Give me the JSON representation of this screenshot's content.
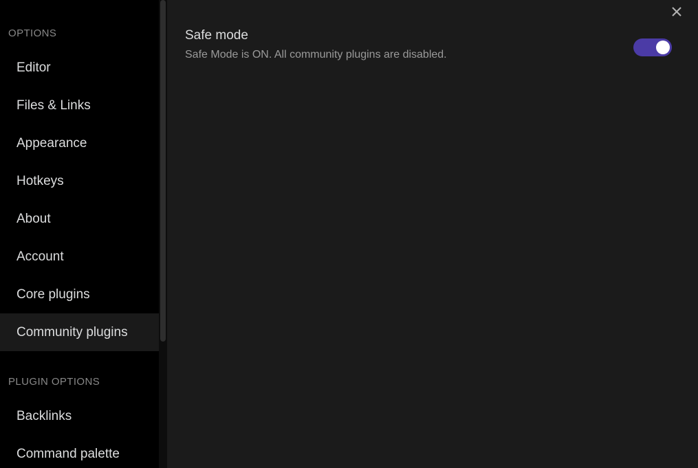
{
  "colors": {
    "sidebar_bg": "#000000",
    "content_bg": "#1b1b1b",
    "active_item_bg": "#1a1a1a",
    "text_primary": "#dcddde",
    "text_muted": "#9a9a9a",
    "section_header": "#888888",
    "toggle_on": "#4b3ba6",
    "toggle_knob": "#ffffff",
    "scrollbar_thumb": "#2e2e2e"
  },
  "sidebar": {
    "sections": [
      {
        "header": "OPTIONS",
        "items": [
          {
            "label": "Editor",
            "active": false
          },
          {
            "label": "Files & Links",
            "active": false
          },
          {
            "label": "Appearance",
            "active": false
          },
          {
            "label": "Hotkeys",
            "active": false
          },
          {
            "label": "About",
            "active": false
          },
          {
            "label": "Account",
            "active": false
          },
          {
            "label": "Core plugins",
            "active": false
          },
          {
            "label": "Community plugins",
            "active": true
          }
        ]
      },
      {
        "header": "PLUGIN OPTIONS",
        "items": [
          {
            "label": "Backlinks",
            "active": false
          },
          {
            "label": "Command palette",
            "active": false
          }
        ]
      }
    ]
  },
  "scrollbar": {
    "thumb_top": 0,
    "thumb_height": 497
  },
  "content": {
    "close_label": "×",
    "settings": [
      {
        "name": "Safe mode",
        "description": "Safe Mode is ON. All community plugins are disabled.",
        "toggle": {
          "state": "on",
          "aria_label": "Safe mode toggle"
        }
      }
    ]
  }
}
